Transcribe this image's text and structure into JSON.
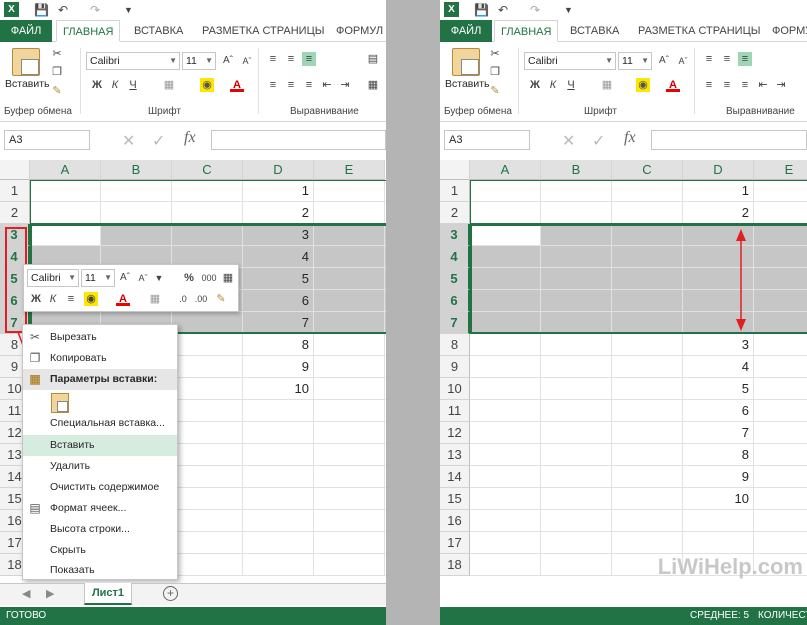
{
  "left": {
    "menu_tabs": {
      "file": "ФАЙЛ",
      "home": "ГЛАВНАЯ",
      "insert": "ВСТАВКА",
      "page_layout": "РАЗМЕТКА СТРАНИЦЫ",
      "formulas": "ФОРМУЛ"
    },
    "ribbon": {
      "paste_label": "Вставить",
      "font_name": "Calibri",
      "font_size": "11",
      "group_clipboard": "Буфер обмена",
      "group_font": "Шрифт",
      "group_alignment": "Выравнивание"
    },
    "name_box": "A3",
    "columns": [
      "A",
      "B",
      "C",
      "D",
      "E"
    ],
    "rows": [
      {
        "n": "1",
        "d": "1"
      },
      {
        "n": "2",
        "d": "2"
      },
      {
        "n": "3",
        "d": "3"
      },
      {
        "n": "4",
        "d": "4"
      },
      {
        "n": "5",
        "d": "5"
      },
      {
        "n": "6",
        "d": "6"
      },
      {
        "n": "7",
        "d": "7"
      },
      {
        "n": "8",
        "d": "8"
      },
      {
        "n": "9",
        "d": "9"
      },
      {
        "n": "10",
        "d": "10"
      },
      {
        "n": "11",
        "d": ""
      },
      {
        "n": "12",
        "d": ""
      },
      {
        "n": "13",
        "d": ""
      },
      {
        "n": "14",
        "d": ""
      },
      {
        "n": "15",
        "d": ""
      },
      {
        "n": "16",
        "d": ""
      },
      {
        "n": "17",
        "d": ""
      },
      {
        "n": "18",
        "d": ""
      }
    ],
    "mini_toolbar": {
      "font_name": "Calibri",
      "font_size": "11",
      "percent": "%",
      "thousands": "000"
    },
    "context_menu": {
      "cut": "Вырезать",
      "copy": "Копировать",
      "paste_options": "Параметры вставки:",
      "paste_special": "Специальная вставка...",
      "insert": "Вставить",
      "delete": "Удалить",
      "clear_contents": "Очистить содержимое",
      "format_cells": "Формат ячеек...",
      "row_height": "Высота строки...",
      "hide": "Скрыть",
      "unhide": "Показать"
    },
    "sheet_tab": "Лист1",
    "status": "ГОТОВО"
  },
  "right": {
    "menu_tabs": {
      "file": "ФАЙЛ",
      "home": "ГЛАВНАЯ",
      "insert": "ВСТАВКА",
      "page_layout": "РАЗМЕТКА СТРАНИЦЫ",
      "formulas": "ФОРМУ"
    },
    "ribbon": {
      "paste_label": "Вставить",
      "font_name": "Calibri",
      "font_size": "11",
      "group_clipboard": "Буфер обмена",
      "group_font": "Шрифт",
      "group_alignment": "Выравнивание"
    },
    "name_box": "A3",
    "columns": [
      "A",
      "B",
      "C",
      "D",
      "E"
    ],
    "rows": [
      {
        "n": "1",
        "d": "1"
      },
      {
        "n": "2",
        "d": "2"
      },
      {
        "n": "3",
        "d": ""
      },
      {
        "n": "4",
        "d": ""
      },
      {
        "n": "5",
        "d": ""
      },
      {
        "n": "6",
        "d": ""
      },
      {
        "n": "7",
        "d": ""
      },
      {
        "n": "8",
        "d": "3"
      },
      {
        "n": "9",
        "d": "4"
      },
      {
        "n": "10",
        "d": "5"
      },
      {
        "n": "11",
        "d": "6"
      },
      {
        "n": "12",
        "d": "7"
      },
      {
        "n": "13",
        "d": "8"
      },
      {
        "n": "14",
        "d": "9"
      },
      {
        "n": "15",
        "d": "10"
      },
      {
        "n": "16",
        "d": ""
      },
      {
        "n": "17",
        "d": ""
      },
      {
        "n": "18",
        "d": ""
      }
    ],
    "status_avg": "СРЕДНЕЕ: 5",
    "status_count": "КОЛИЧЕСТ"
  },
  "watermark": "LiWiHelp.com",
  "colors": {
    "excel_green": "#217346",
    "selection_gray": "#c6c6c6",
    "annotation_red": "#e02020"
  }
}
